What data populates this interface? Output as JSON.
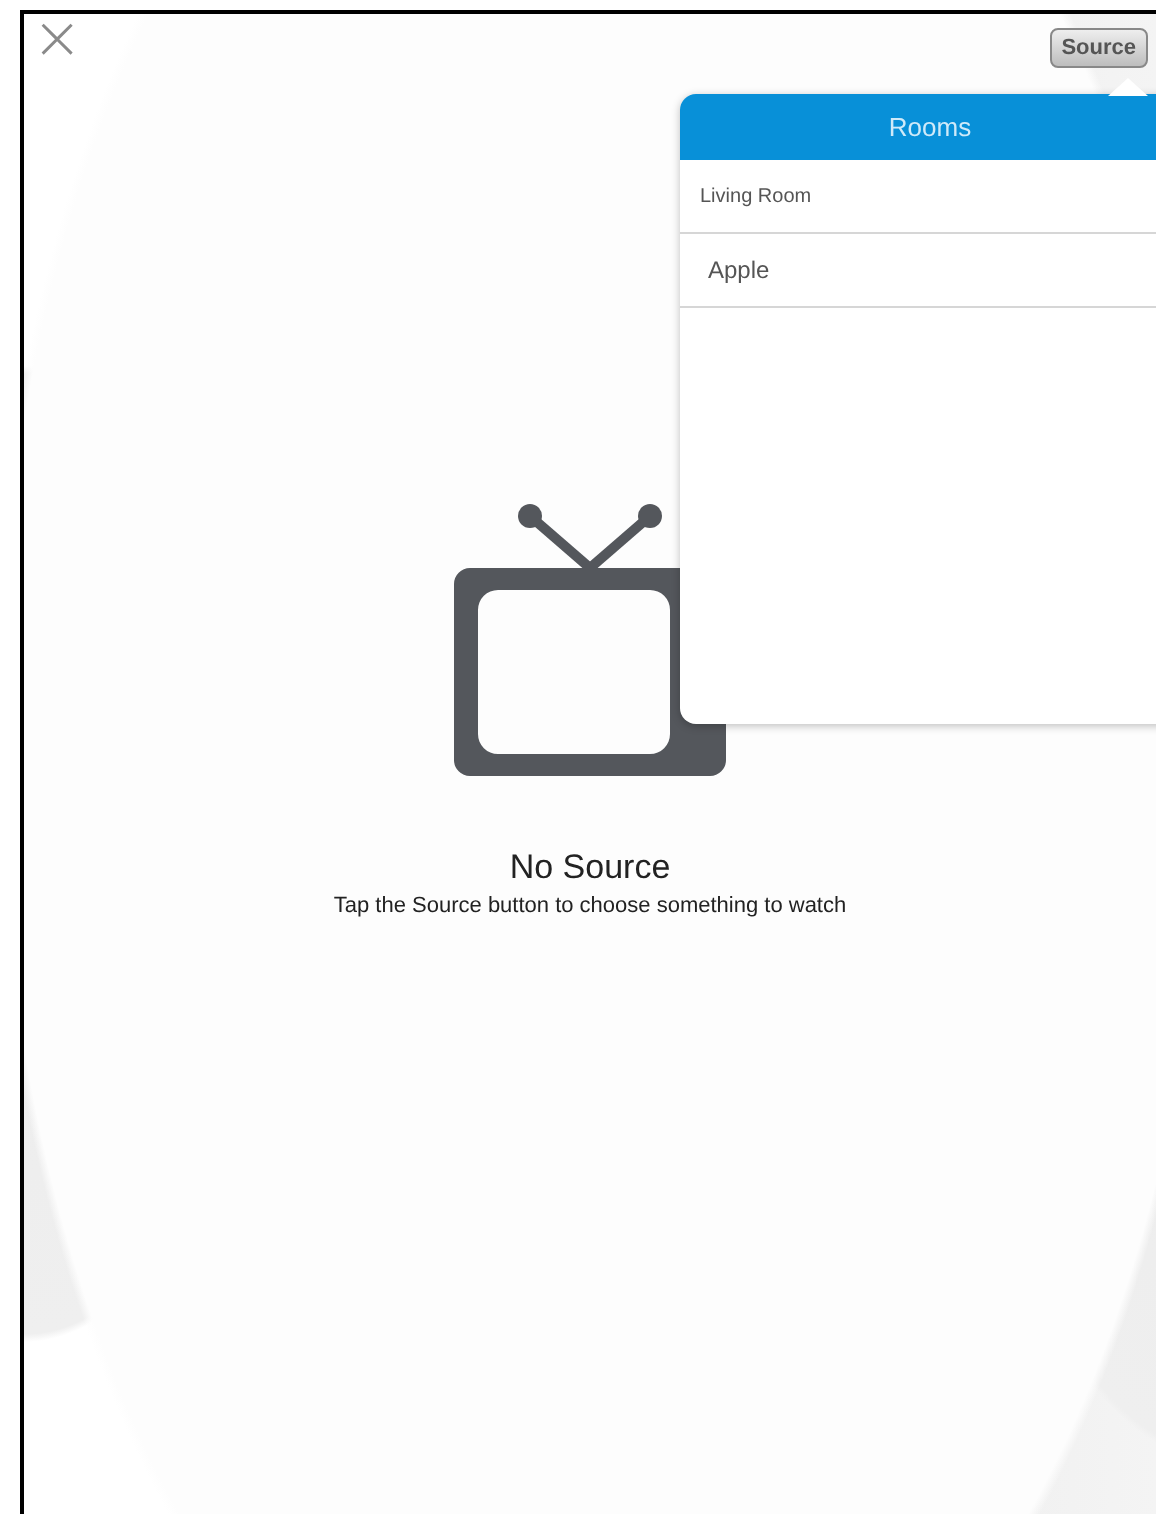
{
  "close_button": {
    "label": "×"
  },
  "source_button": {
    "label": "Source"
  },
  "popover": {
    "title": "Rooms",
    "items": [
      {
        "kind": "room",
        "label": "Living Room"
      },
      {
        "kind": "device",
        "label": "Apple"
      }
    ]
  },
  "empty_state": {
    "title": "No Source",
    "message": "Tap the Source button to choose something to watch"
  }
}
